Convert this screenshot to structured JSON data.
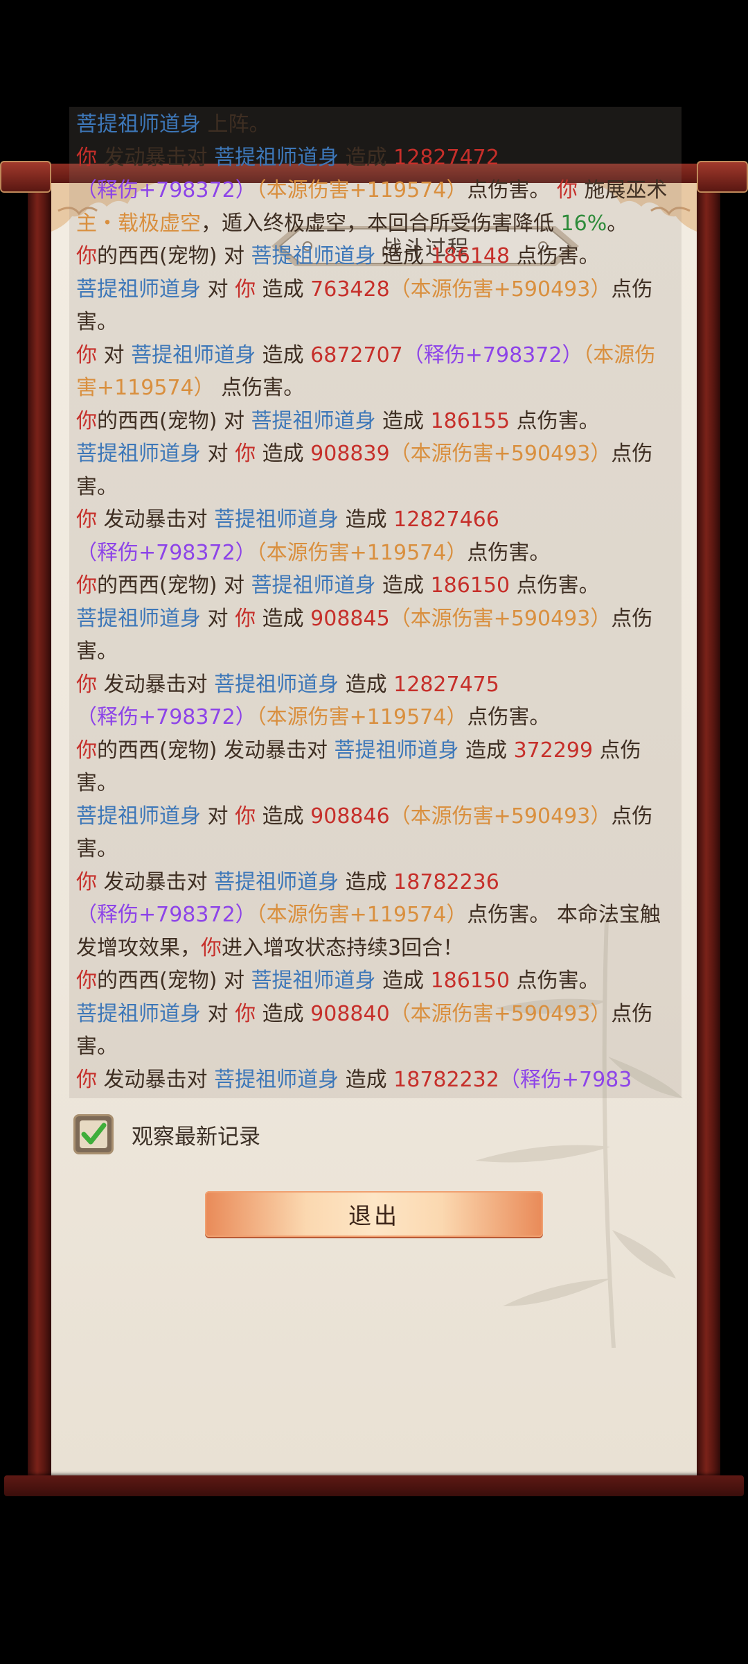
{
  "dialog": {
    "title": "战斗过程",
    "checkbox_label": "观察最新记录",
    "checkbox_checked": true,
    "exit_button": "退出"
  },
  "colors": {
    "name_blue": "#3d77b8",
    "damage_red": "#c62f2a",
    "release_purple": "#8d44e8",
    "source_orange": "#d98f3e",
    "percent_green": "#2e8b3a"
  },
  "log": [
    {
      "segments": [
        {
          "t": "菩提祖师道身",
          "c": "blue"
        },
        {
          "t": " 上阵。",
          "c": ""
        }
      ]
    },
    {
      "segments": [
        {
          "t": "你",
          "c": "red"
        },
        {
          "t": " 发动暴击对 ",
          "c": ""
        },
        {
          "t": "菩提祖师道身",
          "c": "blue"
        },
        {
          "t": " 造成 ",
          "c": ""
        },
        {
          "t": "12827472",
          "c": "red"
        },
        {
          "t": "（释伤+798372）",
          "c": "purple"
        },
        {
          "t": "（本源伤害+119574）",
          "c": "orange"
        },
        {
          "t": "点伤害。 ",
          "c": ""
        },
        {
          "t": "你",
          "c": "red"
        },
        {
          "t": " 施展巫术 ",
          "c": ""
        },
        {
          "t": "主・载极虚空",
          "c": "orange"
        },
        {
          "t": "，遁入终极虚空，本回合所受伤害降低 ",
          "c": ""
        },
        {
          "t": "16%",
          "c": "green"
        },
        {
          "t": "。",
          "c": ""
        }
      ]
    },
    {
      "segments": [
        {
          "t": "你",
          "c": "red"
        },
        {
          "t": "的西西(宠物) 对 ",
          "c": ""
        },
        {
          "t": "菩提祖师道身",
          "c": "blue"
        },
        {
          "t": " 造成 ",
          "c": ""
        },
        {
          "t": "186148",
          "c": "red"
        },
        {
          "t": " 点伤害。",
          "c": ""
        }
      ]
    },
    {
      "segments": [
        {
          "t": "菩提祖师道身",
          "c": "blue"
        },
        {
          "t": " 对 ",
          "c": ""
        },
        {
          "t": "你",
          "c": "red"
        },
        {
          "t": " 造成 ",
          "c": ""
        },
        {
          "t": "763428",
          "c": "red"
        },
        {
          "t": "（本源伤害+590493）",
          "c": "orange"
        },
        {
          "t": "点伤害。",
          "c": ""
        }
      ]
    },
    {
      "segments": [
        {
          "t": "你",
          "c": "red"
        },
        {
          "t": " 对 ",
          "c": ""
        },
        {
          "t": "菩提祖师道身",
          "c": "blue"
        },
        {
          "t": " 造成 ",
          "c": ""
        },
        {
          "t": "6872707",
          "c": "red"
        },
        {
          "t": "（释伤+798372）",
          "c": "purple"
        },
        {
          "t": "（本源伤害+119574）",
          "c": "orange"
        },
        {
          "t": " 点伤害。",
          "c": ""
        }
      ]
    },
    {
      "segments": [
        {
          "t": "你",
          "c": "red"
        },
        {
          "t": "的西西(宠物) 对 ",
          "c": ""
        },
        {
          "t": "菩提祖师道身",
          "c": "blue"
        },
        {
          "t": " 造成 ",
          "c": ""
        },
        {
          "t": "186155",
          "c": "red"
        },
        {
          "t": " 点伤害。",
          "c": ""
        }
      ]
    },
    {
      "segments": [
        {
          "t": "菩提祖师道身",
          "c": "blue"
        },
        {
          "t": " 对 ",
          "c": ""
        },
        {
          "t": "你",
          "c": "red"
        },
        {
          "t": " 造成 ",
          "c": ""
        },
        {
          "t": "908839",
          "c": "red"
        },
        {
          "t": "（本源伤害+590493）",
          "c": "orange"
        },
        {
          "t": "点伤害。",
          "c": ""
        }
      ]
    },
    {
      "segments": [
        {
          "t": "你",
          "c": "red"
        },
        {
          "t": " 发动暴击对 ",
          "c": ""
        },
        {
          "t": "菩提祖师道身",
          "c": "blue"
        },
        {
          "t": " 造成 ",
          "c": ""
        },
        {
          "t": "12827466",
          "c": "red"
        },
        {
          "t": "（释伤+798372）",
          "c": "purple"
        },
        {
          "t": "（本源伤害+119574）",
          "c": "orange"
        },
        {
          "t": "点伤害。",
          "c": ""
        }
      ]
    },
    {
      "segments": [
        {
          "t": "你",
          "c": "red"
        },
        {
          "t": "的西西(宠物) 对 ",
          "c": ""
        },
        {
          "t": "菩提祖师道身",
          "c": "blue"
        },
        {
          "t": " 造成 ",
          "c": ""
        },
        {
          "t": "186150",
          "c": "red"
        },
        {
          "t": " 点伤害。",
          "c": ""
        }
      ]
    },
    {
      "segments": [
        {
          "t": "菩提祖师道身",
          "c": "blue"
        },
        {
          "t": " 对 ",
          "c": ""
        },
        {
          "t": "你",
          "c": "red"
        },
        {
          "t": " 造成 ",
          "c": ""
        },
        {
          "t": "908845",
          "c": "red"
        },
        {
          "t": "（本源伤害+590493）",
          "c": "orange"
        },
        {
          "t": "点伤害。",
          "c": ""
        }
      ]
    },
    {
      "segments": [
        {
          "t": "你",
          "c": "red"
        },
        {
          "t": " 发动暴击对 ",
          "c": ""
        },
        {
          "t": "菩提祖师道身",
          "c": "blue"
        },
        {
          "t": " 造成 ",
          "c": ""
        },
        {
          "t": "12827475",
          "c": "red"
        },
        {
          "t": "（释伤+798372）",
          "c": "purple"
        },
        {
          "t": "（本源伤害+119574）",
          "c": "orange"
        },
        {
          "t": "点伤害。",
          "c": ""
        }
      ]
    },
    {
      "segments": [
        {
          "t": "你",
          "c": "red"
        },
        {
          "t": "的西西(宠物) 发动暴击对 ",
          "c": ""
        },
        {
          "t": "菩提祖师道身",
          "c": "blue"
        },
        {
          "t": " 造成 ",
          "c": ""
        },
        {
          "t": "372299",
          "c": "red"
        },
        {
          "t": " 点伤害。",
          "c": ""
        }
      ]
    },
    {
      "segments": [
        {
          "t": "菩提祖师道身",
          "c": "blue"
        },
        {
          "t": " 对 ",
          "c": ""
        },
        {
          "t": "你",
          "c": "red"
        },
        {
          "t": " 造成 ",
          "c": ""
        },
        {
          "t": "908846",
          "c": "red"
        },
        {
          "t": "（本源伤害+590493）",
          "c": "orange"
        },
        {
          "t": "点伤害。",
          "c": ""
        }
      ]
    },
    {
      "segments": [
        {
          "t": "你",
          "c": "red"
        },
        {
          "t": " 发动暴击对 ",
          "c": ""
        },
        {
          "t": "菩提祖师道身",
          "c": "blue"
        },
        {
          "t": " 造成 ",
          "c": ""
        },
        {
          "t": "18782236",
          "c": "red"
        },
        {
          "t": "（释伤+798372）",
          "c": "purple"
        },
        {
          "t": "（本源伤害+119574）",
          "c": "orange"
        },
        {
          "t": "点伤害。 本命法宝触发增攻效果，",
          "c": ""
        },
        {
          "t": "你",
          "c": "red"
        },
        {
          "t": "进入增攻状态持续3回合！",
          "c": ""
        }
      ]
    },
    {
      "segments": [
        {
          "t": "你",
          "c": "red"
        },
        {
          "t": "的西西(宠物) 对 ",
          "c": ""
        },
        {
          "t": "菩提祖师道身",
          "c": "blue"
        },
        {
          "t": " 造成 ",
          "c": ""
        },
        {
          "t": "186150",
          "c": "red"
        },
        {
          "t": " 点伤害。",
          "c": ""
        }
      ]
    },
    {
      "segments": [
        {
          "t": "菩提祖师道身",
          "c": "blue"
        },
        {
          "t": " 对 ",
          "c": ""
        },
        {
          "t": "你",
          "c": "red"
        },
        {
          "t": " 造成 ",
          "c": ""
        },
        {
          "t": "908840",
          "c": "red"
        },
        {
          "t": "（本源伤害+590493）",
          "c": "orange"
        },
        {
          "t": "点伤害。",
          "c": ""
        }
      ]
    },
    {
      "segments": [
        {
          "t": "你",
          "c": "red"
        },
        {
          "t": " 发动暴击对 ",
          "c": ""
        },
        {
          "t": "菩提祖师道身",
          "c": "blue"
        },
        {
          "t": " 造成 ",
          "c": ""
        },
        {
          "t": "18782232",
          "c": "red"
        },
        {
          "t": "（释伤+7983",
          "c": "purple"
        }
      ]
    }
  ]
}
